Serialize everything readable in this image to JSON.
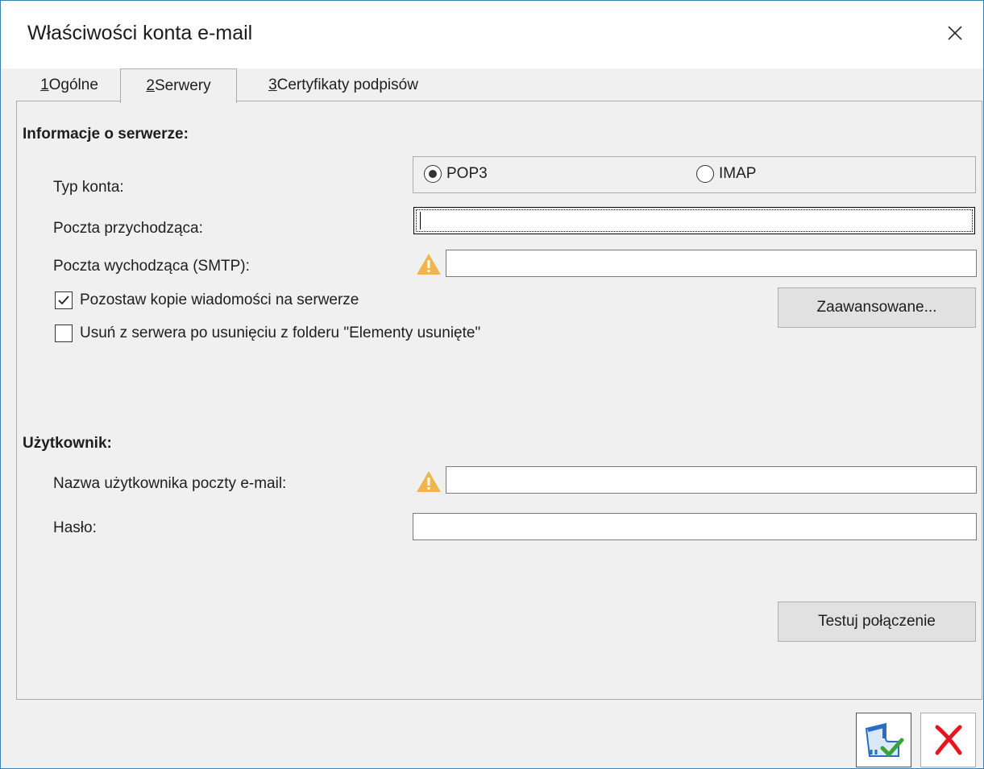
{
  "window": {
    "title": "Właściwości konta e-mail"
  },
  "tabs": [
    {
      "key": "1",
      "label": " Ogólne"
    },
    {
      "key": "2",
      "label": " Serwery"
    },
    {
      "key": "3",
      "label": " Certyfikaty podpisów"
    }
  ],
  "active_tab": "2 Serwery",
  "server": {
    "heading": "Informacje o serwerze:",
    "account_type_label": "Typ konta:",
    "account_type_options": [
      "POP3",
      "IMAP"
    ],
    "account_type_selected": "POP3",
    "incoming_label": "Poczta przychodząca:",
    "incoming_value": "",
    "outgoing_label": "Poczta wychodząca (SMTP):",
    "outgoing_value": "",
    "keep_copies_label": "Pozostaw kopie wiadomości na serwerze",
    "keep_copies_checked": true,
    "delete_label": "Usuń z serwera po usunięciu z folderu \"Elementy usunięte\"",
    "delete_checked": false,
    "advanced_button": "Zaawansowane..."
  },
  "user": {
    "heading": "Użytkownik:",
    "username_label": "Nazwa użytkownika poczty e-mail:",
    "username_value": "",
    "password_label": "Hasło:",
    "password_value": "",
    "test_button": "Testuj połączenie"
  },
  "icons": {
    "close": "close-icon",
    "warning": "warning-icon",
    "save": "save-icon",
    "cancel": "cancel-icon"
  },
  "colors": {
    "window_border": "#3c7fb1",
    "warning": "#f0b64e",
    "cancel_red": "#e8141e",
    "save_blue": "#2b6cc9",
    "check_green": "#3aa23a"
  }
}
